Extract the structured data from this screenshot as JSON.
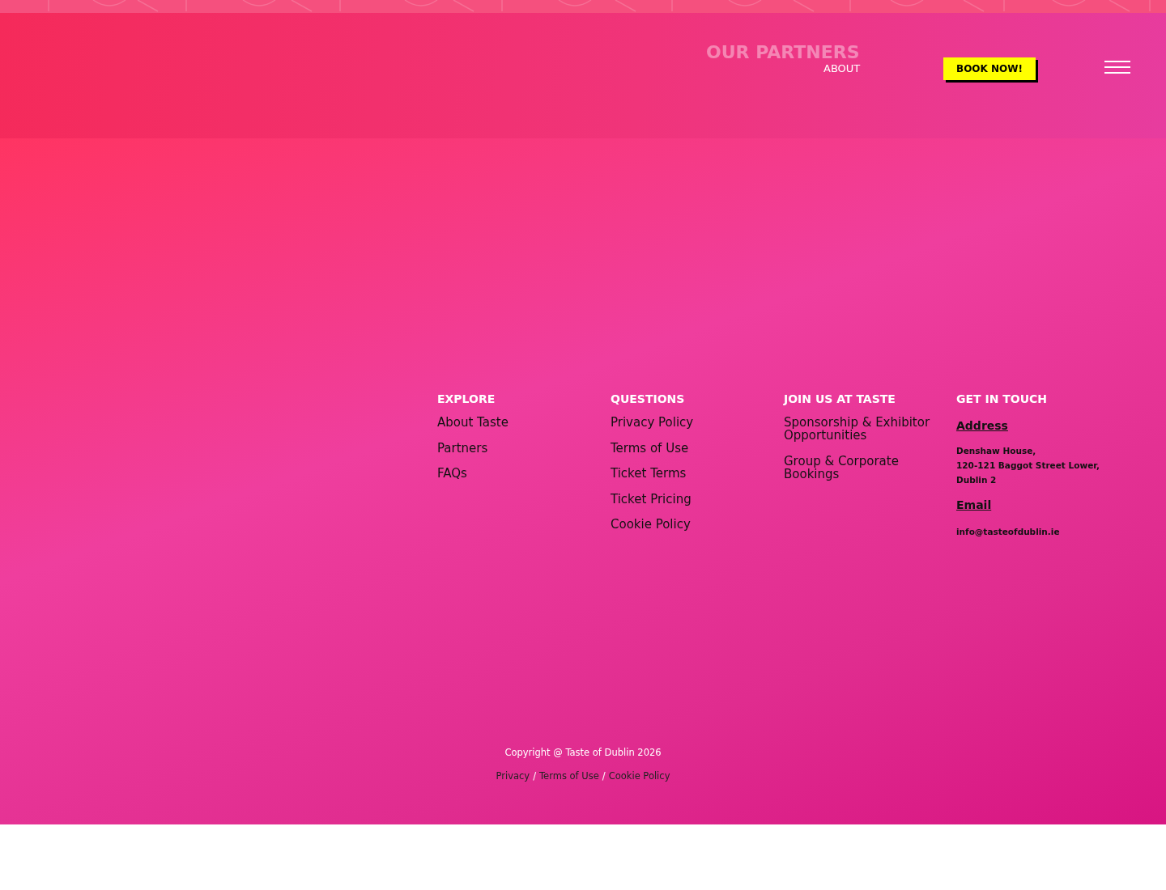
{
  "header": {
    "faded_link": "OUR PARTNERS",
    "nav_link": "ABOUT",
    "book_button": "BOOK NOW!"
  },
  "footer": {
    "columns": [
      {
        "heading": "EXPLORE",
        "links": [
          "About Taste",
          "Partners",
          "FAQs"
        ]
      },
      {
        "heading": "QUESTIONS",
        "links": [
          "Privacy Policy",
          "Terms of Use",
          "Ticket Terms",
          "Ticket Pricing",
          "Cookie Policy"
        ]
      },
      {
        "heading": "JOIN US AT TASTE",
        "links": [
          "Sponsorship & Exhibitor Opportunities",
          "Group & Corporate Bookings"
        ]
      }
    ],
    "contact": {
      "heading": "GET IN TOUCH",
      "address_label": "Address",
      "address_lines": [
        "Denshaw House,",
        "120-121 Baggot Street Lower,",
        "Dublin 2"
      ],
      "email_label": "Email",
      "email": "info@tasteofdublin.ie"
    },
    "copyright": "Copyright @ Taste of Dublin 2026",
    "legal_links": [
      "Privacy",
      "Terms of Use",
      "Cookie Policy"
    ],
    "separator": "/"
  }
}
